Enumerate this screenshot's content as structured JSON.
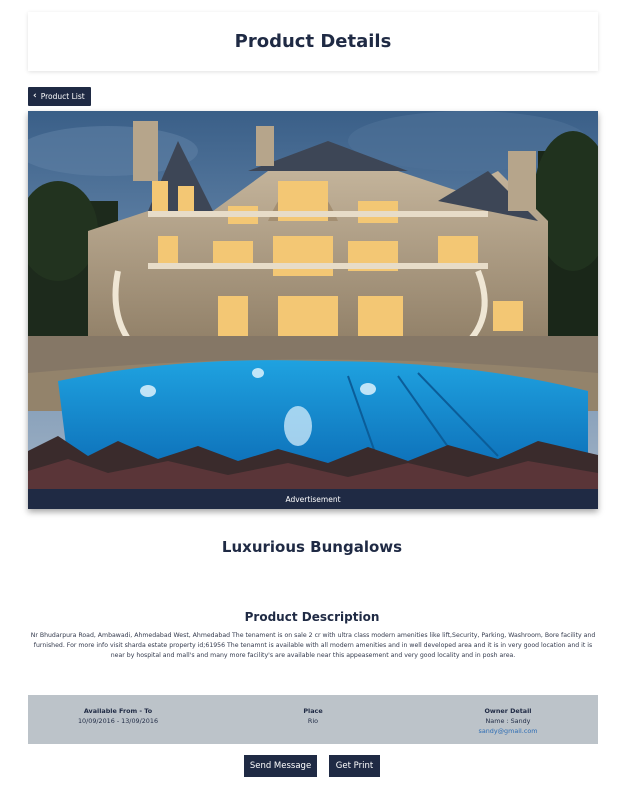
{
  "header": {
    "title": "Product Details"
  },
  "nav": {
    "back_label": "Product List"
  },
  "hero": {
    "ad_label": "Advertisement"
  },
  "product": {
    "name": "Luxurious Bungalows",
    "description_heading": "Product Description",
    "description": "Nr Bhudarpura Road, Ambawadi, Ahmedabad West, Ahmedabad The tenament is on sale 2 cr with ultra class modern amenities like lift,Security, Parking, Washroom, Bore facility and furnished. For more info visit sharda estate property id;61956 The tenamnt is available with all modern amenities and in well developed area and it is in very good location and it is near by hospital and mall's and many more facility's are available near this appeasement and very good locality and in posh area."
  },
  "info": {
    "available_label": "Available From - To",
    "available_value": "10/09/2016 - 13/09/2016",
    "place_label": "Place",
    "place_value": "Rio",
    "owner_label": "Owner Detail",
    "owner_name": "Name : Sandy",
    "owner_email": "sandy@gmail.com"
  },
  "actions": {
    "send_message": "Send Message",
    "get_print": "Get Print"
  },
  "colors": {
    "primary": "#1f2a44",
    "info_bar": "#bcc3c9",
    "link": "#2e6db4"
  }
}
